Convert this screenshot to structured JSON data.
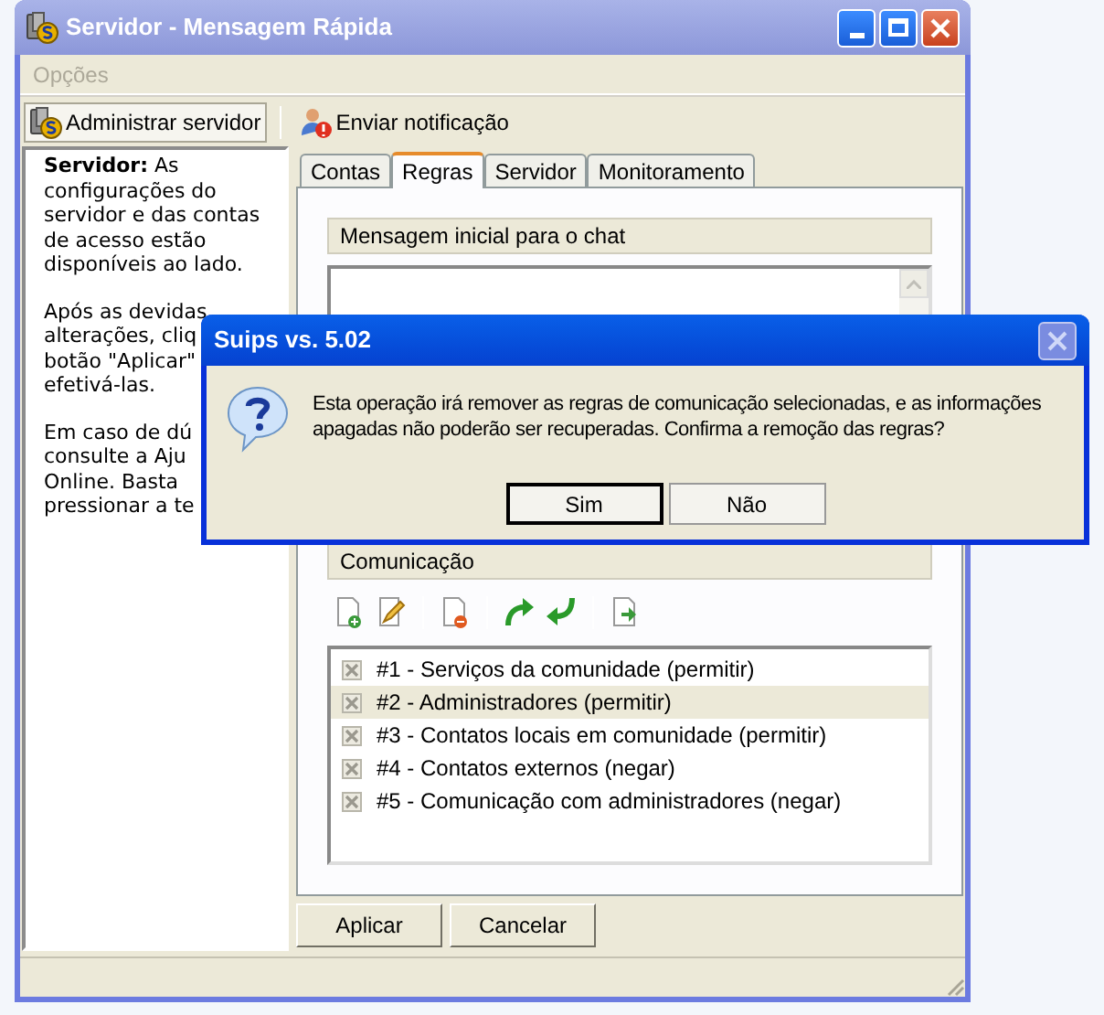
{
  "window": {
    "title": "Servidor - Mensagem Rápida"
  },
  "menu": [
    {
      "label": "Opções",
      "disabled": true
    }
  ],
  "toolbar": [
    {
      "label": "Administrar servidor",
      "selected": true
    },
    {
      "label": "Enviar notificação",
      "selected": false
    }
  ],
  "help_panel": {
    "paragraphs": [
      [
        "**Servidor:** As",
        "configurações do",
        "servidor e das contas",
        "de acesso estão",
        "disponíveis ao lado."
      ],
      [
        "Após as devidas",
        "alterações, cliq",
        "botão \"Aplicar\"",
        "efetivá-las."
      ],
      [
        "Em caso de dú",
        "consulte a Aju",
        "Online. Basta",
        "pressionar a te"
      ]
    ]
  },
  "tabs": [
    {
      "label": "Contas",
      "selected": false
    },
    {
      "label": "Regras",
      "selected": true
    },
    {
      "label": "Servidor",
      "selected": false
    },
    {
      "label": "Monitoramento",
      "selected": false
    }
  ],
  "welcome_group": {
    "title": "Mensagem inicial para o chat"
  },
  "rules_group": {
    "title": "Comunicação",
    "rules": [
      {
        "label": "#1 - Serviços da comunidade (permitir)",
        "checked": true,
        "selected": false
      },
      {
        "label": "#2 - Administradores (permitir)",
        "checked": true,
        "selected": true
      },
      {
        "label": "#3 - Contatos locais em comunidade (permitir)",
        "checked": true,
        "selected": false
      },
      {
        "label": "#4 - Contatos externos (negar)",
        "checked": true,
        "selected": false
      },
      {
        "label": "#5 - Comunicação com administradores (negar)",
        "checked": true,
        "selected": false
      }
    ]
  },
  "buttons": [
    "Aplicar",
    "Cancelar"
  ],
  "dialog": {
    "title": "Suips vs. 5.02",
    "message": "Esta operação irá remover as regras de comunicação selecionadas, e as informações apagadas não poderão ser recuperadas. Confirma a remoção das regras?",
    "buttons": [
      {
        "label": "Sim",
        "default": true
      },
      {
        "label": "Não",
        "default": false
      }
    ]
  }
}
